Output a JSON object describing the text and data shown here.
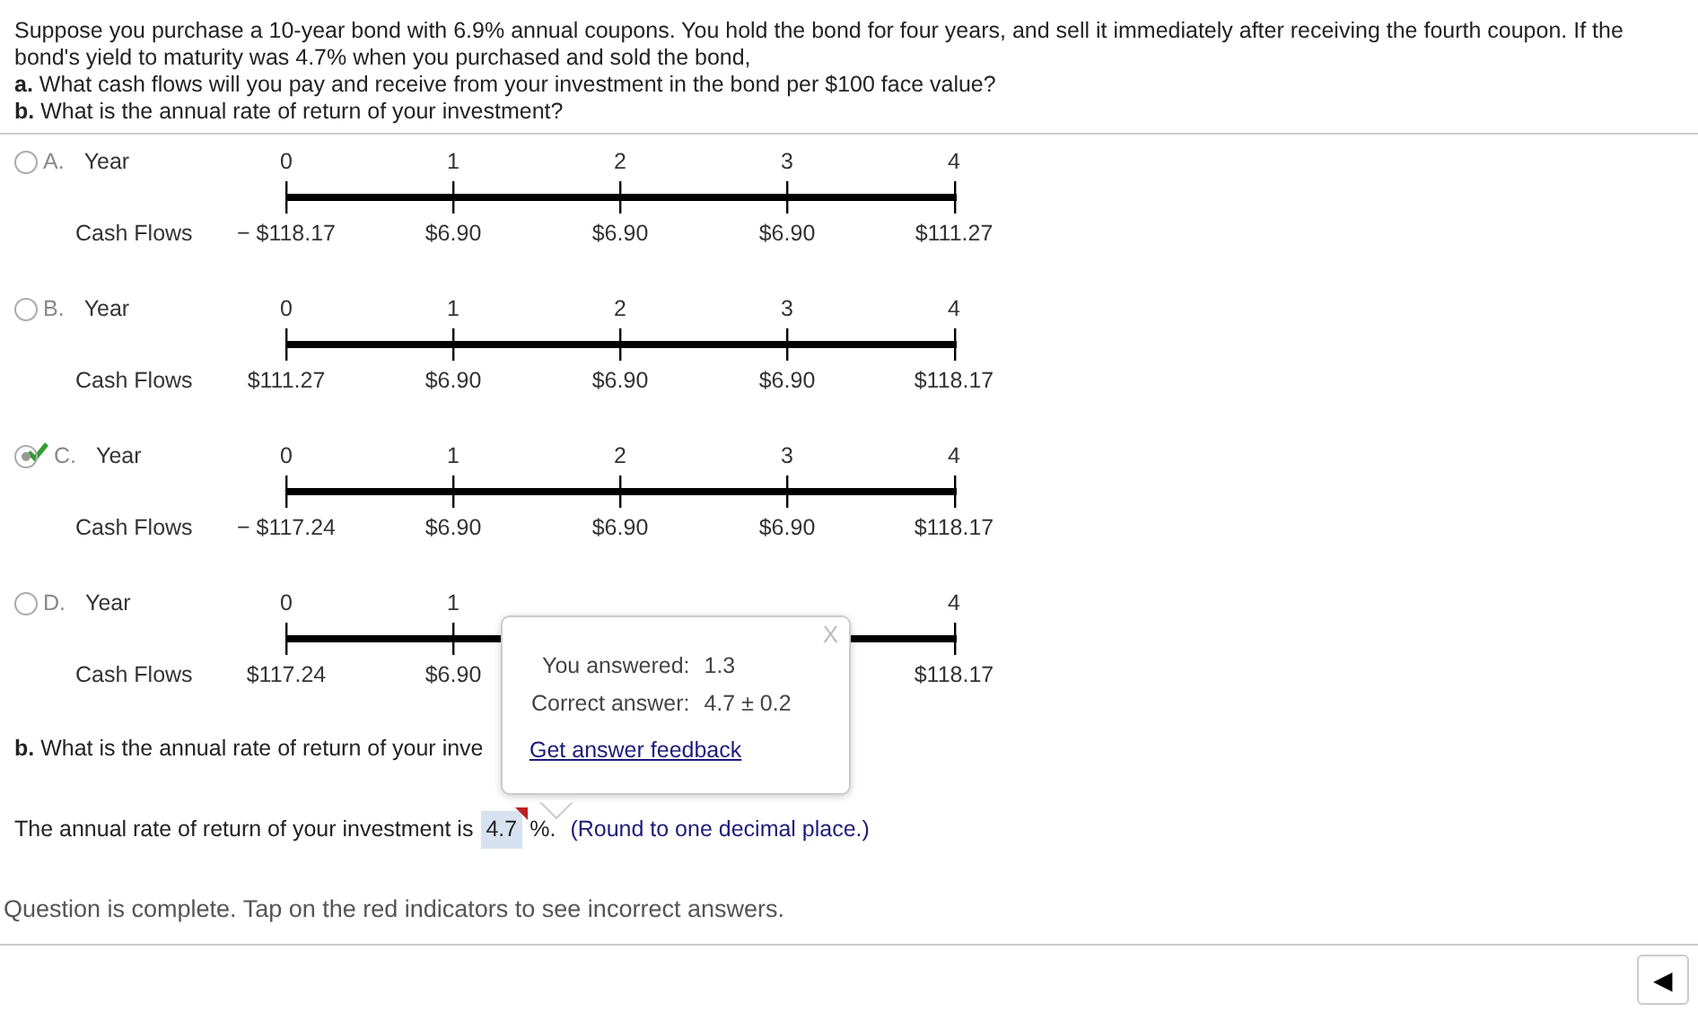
{
  "question": {
    "intro": "Suppose you purchase a 10-year bond with 6.9% annual coupons. You hold the bond for four years, and sell it immediately after receiving the fourth coupon. If the bond's yield to maturity was 4.7% when you purchased and sold the bond,",
    "parts": [
      "**a.** What cash flows will you pay and receive from your investment in the bond per $100 face value?",
      "**b.** What is the annual rate of return of your investment?"
    ]
  },
  "options": [
    {
      "letter": "A.",
      "selected": false,
      "correct": false,
      "year_label": "Year",
      "flow_label": "Cash Flows",
      "years": [
        "0",
        "1",
        "2",
        "3",
        "4"
      ],
      "cash_flows": [
        "− $118.17",
        "$6.90",
        "$6.90",
        "$6.90",
        "$111.27"
      ]
    },
    {
      "letter": "B.",
      "selected": false,
      "correct": false,
      "year_label": "Year",
      "flow_label": "Cash Flows",
      "years": [
        "0",
        "1",
        "2",
        "3",
        "4"
      ],
      "cash_flows": [
        "$111.27",
        "$6.90",
        "$6.90",
        "$6.90",
        "$118.17"
      ]
    },
    {
      "letter": "C.",
      "selected": true,
      "correct": true,
      "year_label": "Year",
      "flow_label": "Cash Flows",
      "years": [
        "0",
        "1",
        "2",
        "3",
        "4"
      ],
      "cash_flows": [
        "− $117.24",
        "$6.90",
        "$6.90",
        "$6.90",
        "$118.17"
      ]
    },
    {
      "letter": "D.",
      "selected": false,
      "correct": false,
      "year_label": "Year",
      "flow_label": "Cash Flows",
      "years": [
        "0",
        "1"
      ],
      "years_end": [
        "4"
      ],
      "cash_flows": [
        "$117.24",
        "$6.90"
      ],
      "cash_flows_end": [
        "$118.17"
      ]
    }
  ],
  "part_b": {
    "question": "**b.** What is the annual rate of return of your inve",
    "answer_prefix": "The annual rate of return of your investment is",
    "answer_value": "4.7",
    "incorrect": true,
    "answer_suffix": "%.",
    "hint": "(Round to one decimal place.)"
  },
  "feedback_popup": {
    "close": "X",
    "you_answered_label": "You answered:",
    "you_answered": "1.3",
    "correct_label": "Correct answer:",
    "correct_answer": "4.7 ± 0.2",
    "link": "Get answer feedback"
  },
  "status": "Question is complete. Tap on the red indicators to see incorrect answers.",
  "nav_button": "◀"
}
